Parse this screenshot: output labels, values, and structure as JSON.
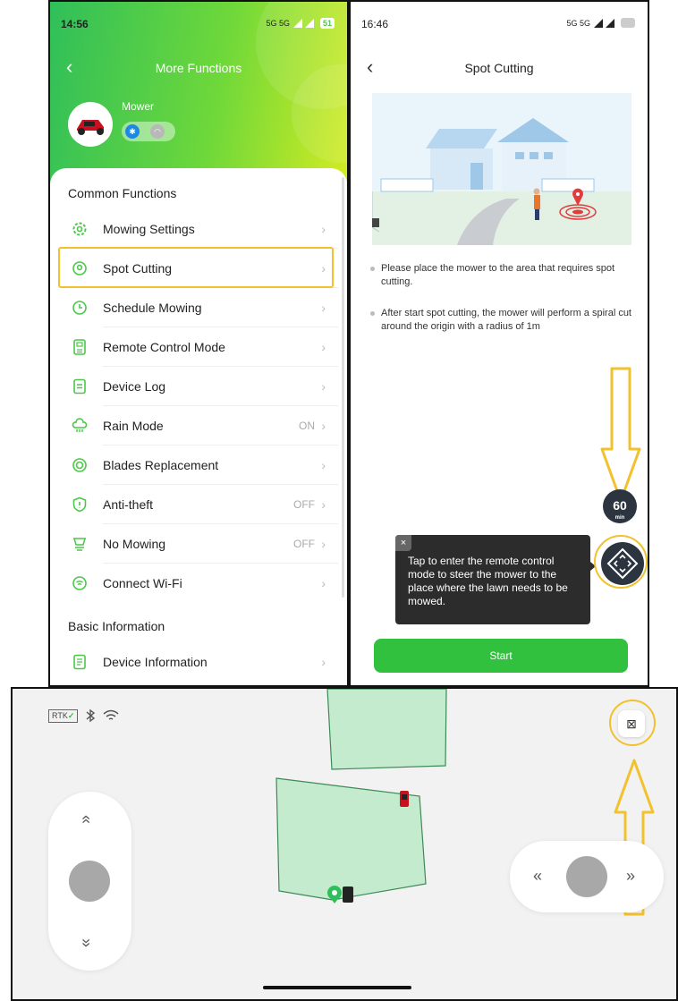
{
  "colors": {
    "accent_green": "#31c13f",
    "highlight_yellow": "#f2c12e",
    "dark_button": "#2c3440",
    "zone_fill": "#c5ebcf",
    "zone_stroke": "#3b8a57"
  },
  "settings_screen": {
    "status_time": "14:56",
    "status_network": "5G 5G",
    "battery": "51",
    "title": "More Functions",
    "device_name": "Mower",
    "section_common": "Common Functions",
    "section_basic": "Basic Information",
    "menu_items": [
      {
        "label": "Mowing Settings",
        "icon": "gear-icon",
        "value": ""
      },
      {
        "label": "Spot Cutting",
        "icon": "location-pin-icon",
        "value": ""
      },
      {
        "label": "Schedule Mowing",
        "icon": "clock-icon",
        "value": ""
      },
      {
        "label": "Remote Control Mode",
        "icon": "remote-icon",
        "value": ""
      },
      {
        "label": "Device Log",
        "icon": "log-icon",
        "value": ""
      },
      {
        "label": "Rain Mode",
        "icon": "rain-cloud-icon",
        "value": "ON"
      },
      {
        "label": "Blades Replacement",
        "icon": "blade-icon",
        "value": ""
      },
      {
        "label": "Anti-theft",
        "icon": "shield-icon",
        "value": "OFF"
      },
      {
        "label": "No Mowing",
        "icon": "no-mowing-icon",
        "value": "OFF"
      },
      {
        "label": "Connect Wi-Fi",
        "icon": "wifi-icon",
        "value": ""
      }
    ],
    "basic_items": [
      {
        "label": "Device Information",
        "icon": "document-icon",
        "value": ""
      }
    ]
  },
  "spot_screen": {
    "status_time": "16:46",
    "status_network": "5G 5G",
    "battery": "",
    "title": "Spot Cutting",
    "instructions": [
      "Please place the mower to the area that requires spot cutting.",
      "After start spot cutting, the mower will perform a spiral cut around the origin with a radius of 1m"
    ],
    "timer_value": "60",
    "timer_unit": "min",
    "tooltip_close": "×",
    "tooltip_text": "Tap to enter the remote control mode to steer the mower to the place where the lawn needs to be mowed.",
    "start_label": "Start"
  },
  "remote_screen": {
    "rtk_label": "RTK",
    "rtk_check": "✓",
    "exit_icon": "⊠",
    "up_arrow": "«",
    "down_arrow": "»",
    "left_arrow": "«",
    "right_arrow": "»"
  }
}
